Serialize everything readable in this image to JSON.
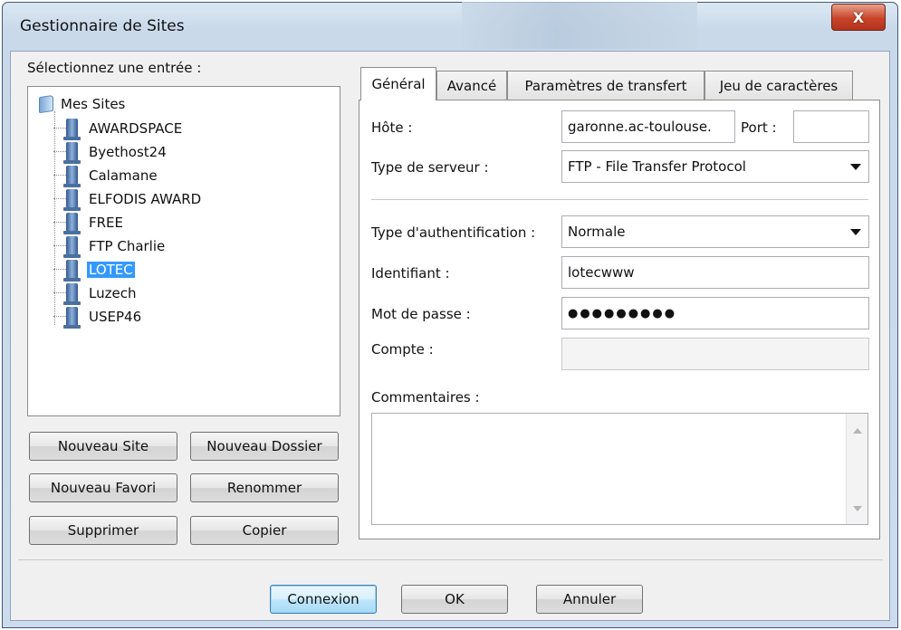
{
  "window": {
    "title": "Gestionnaire de Sites",
    "close_glyph": "X"
  },
  "left": {
    "label": "Sélectionnez une entrée :",
    "tree": {
      "root": "Mes Sites",
      "items": [
        "AWARDSPACE",
        "Byethost24",
        "Calamane",
        "ELFODIS AWARD",
        "FREE",
        "FTP Charlie",
        "LOTEC",
        "Luzech",
        "USEP46"
      ],
      "selected": "LOTEC"
    },
    "buttons": {
      "new_site": "Nouveau Site",
      "new_folder": "Nouveau Dossier",
      "new_bookmark": "Nouveau Favori",
      "rename": "Renommer",
      "delete": "Supprimer",
      "copy": "Copier"
    }
  },
  "tabs": [
    "Général",
    "Avancé",
    "Paramètres de transfert",
    "Jeu de caractères"
  ],
  "active_tab": "Général",
  "general": {
    "host_label": "Hôte :",
    "host_value": "garonne.ac-toulouse.",
    "port_label": "Port :",
    "port_value": "",
    "server_type_label": "Type de serveur :",
    "server_type_value": "FTP - File Transfer Protocol",
    "auth_type_label": "Type d'authentification :",
    "auth_type_value": "Normale",
    "user_label": "Identifiant :",
    "user_value": "lotecwww",
    "password_label": "Mot de passe :",
    "password_value": "●●●●●●●●●",
    "account_label": "Compte :",
    "account_value": "",
    "comments_label": "Commentaires :",
    "comments_value": ""
  },
  "footer": {
    "connect": "Connexion",
    "ok": "OK",
    "cancel": "Annuler"
  },
  "colors": {
    "selection": "#3399ff",
    "close_button": "#c7442a",
    "default_button_border": "#3c7fb1"
  }
}
